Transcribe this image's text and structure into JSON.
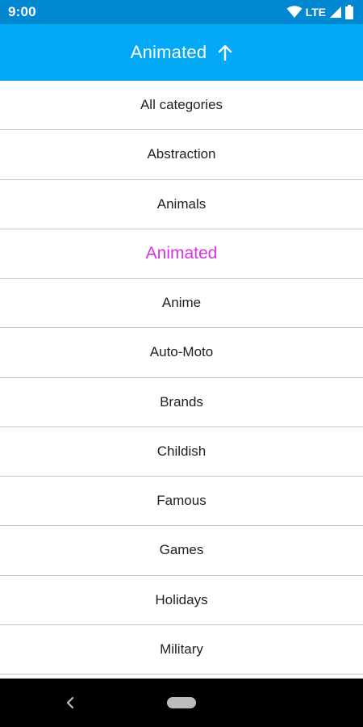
{
  "status_bar": {
    "time": "9:00",
    "network_label": "LTE",
    "icons": [
      "wifi-icon",
      "signal-icon",
      "battery-icon"
    ]
  },
  "app_bar": {
    "title": "Animated",
    "sort_icon": "arrow-up-icon"
  },
  "categories": {
    "items": [
      "All categories",
      "Abstraction",
      "Animals",
      "Animated",
      "Anime",
      "Auto-Moto",
      "Brands",
      "Childish",
      "Famous",
      "Games",
      "Holidays",
      "Military"
    ],
    "selected": "Animated"
  },
  "nav_bar": {
    "icons": [
      "back-icon",
      "home-pill-icon"
    ]
  },
  "colors": {
    "status_bar_bg": "#0288d1",
    "app_bar_bg": "#03a9f4",
    "selected_text": "#d633e0",
    "item_text": "#212121",
    "divider": "#c8c8c8",
    "nav_bar_bg": "#000000"
  }
}
